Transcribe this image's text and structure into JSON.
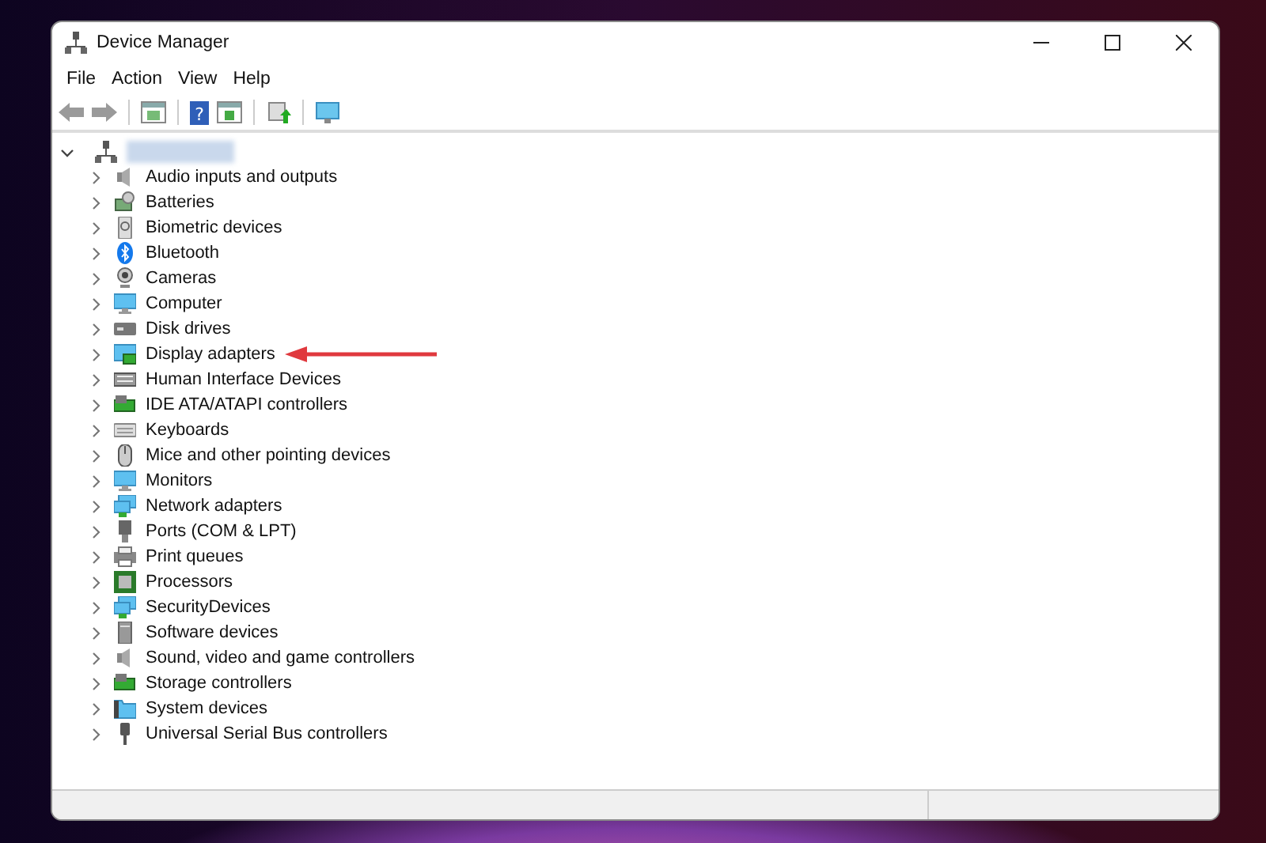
{
  "window": {
    "title": "Device Manager"
  },
  "menu": [
    "File",
    "Action",
    "View",
    "Help"
  ],
  "toolbar": {
    "help_glyph": "?"
  },
  "tree": {
    "expanded": true,
    "children": [
      {
        "label": "Audio inputs and outputs",
        "kind": "speaker",
        "expanded": false,
        "annotated": false
      },
      {
        "label": "Batteries",
        "kind": "battery",
        "expanded": false,
        "annotated": false
      },
      {
        "label": "Biometric devices",
        "kind": "fingerprint",
        "expanded": false,
        "annotated": false
      },
      {
        "label": "Bluetooth",
        "kind": "bluetooth",
        "expanded": false,
        "annotated": false
      },
      {
        "label": "Cameras",
        "kind": "camera",
        "expanded": false,
        "annotated": false
      },
      {
        "label": "Computer",
        "kind": "monitor",
        "expanded": false,
        "annotated": false
      },
      {
        "label": "Disk drives",
        "kind": "drive",
        "expanded": false,
        "annotated": false
      },
      {
        "label": "Display adapters",
        "kind": "display",
        "expanded": false,
        "annotated": true
      },
      {
        "label": "Human Interface Devices",
        "kind": "hid",
        "expanded": false,
        "annotated": false
      },
      {
        "label": "IDE ATA/ATAPI controllers",
        "kind": "card",
        "expanded": false,
        "annotated": false
      },
      {
        "label": "Keyboards",
        "kind": "keyboard",
        "expanded": false,
        "annotated": false
      },
      {
        "label": "Mice and other pointing devices",
        "kind": "mouse",
        "expanded": false,
        "annotated": false
      },
      {
        "label": "Monitors",
        "kind": "monitor",
        "expanded": false,
        "annotated": false
      },
      {
        "label": "Network adapters",
        "kind": "network",
        "expanded": false,
        "annotated": false
      },
      {
        "label": "Ports (COM & LPT)",
        "kind": "port",
        "expanded": false,
        "annotated": false
      },
      {
        "label": "Print queues",
        "kind": "printer",
        "expanded": false,
        "annotated": false
      },
      {
        "label": "Processors",
        "kind": "chip",
        "expanded": false,
        "annotated": false
      },
      {
        "label": "SecurityDevices",
        "kind": "network",
        "expanded": false,
        "annotated": false
      },
      {
        "label": "Software devices",
        "kind": "tower",
        "expanded": false,
        "annotated": false
      },
      {
        "label": "Sound, video and game controllers",
        "kind": "speaker",
        "expanded": false,
        "annotated": false
      },
      {
        "label": "Storage controllers",
        "kind": "card",
        "expanded": false,
        "annotated": false
      },
      {
        "label": "System devices",
        "kind": "folder",
        "expanded": false,
        "annotated": false
      },
      {
        "label": "Universal Serial Bus controllers",
        "kind": "usb",
        "expanded": false,
        "annotated": false
      }
    ]
  }
}
